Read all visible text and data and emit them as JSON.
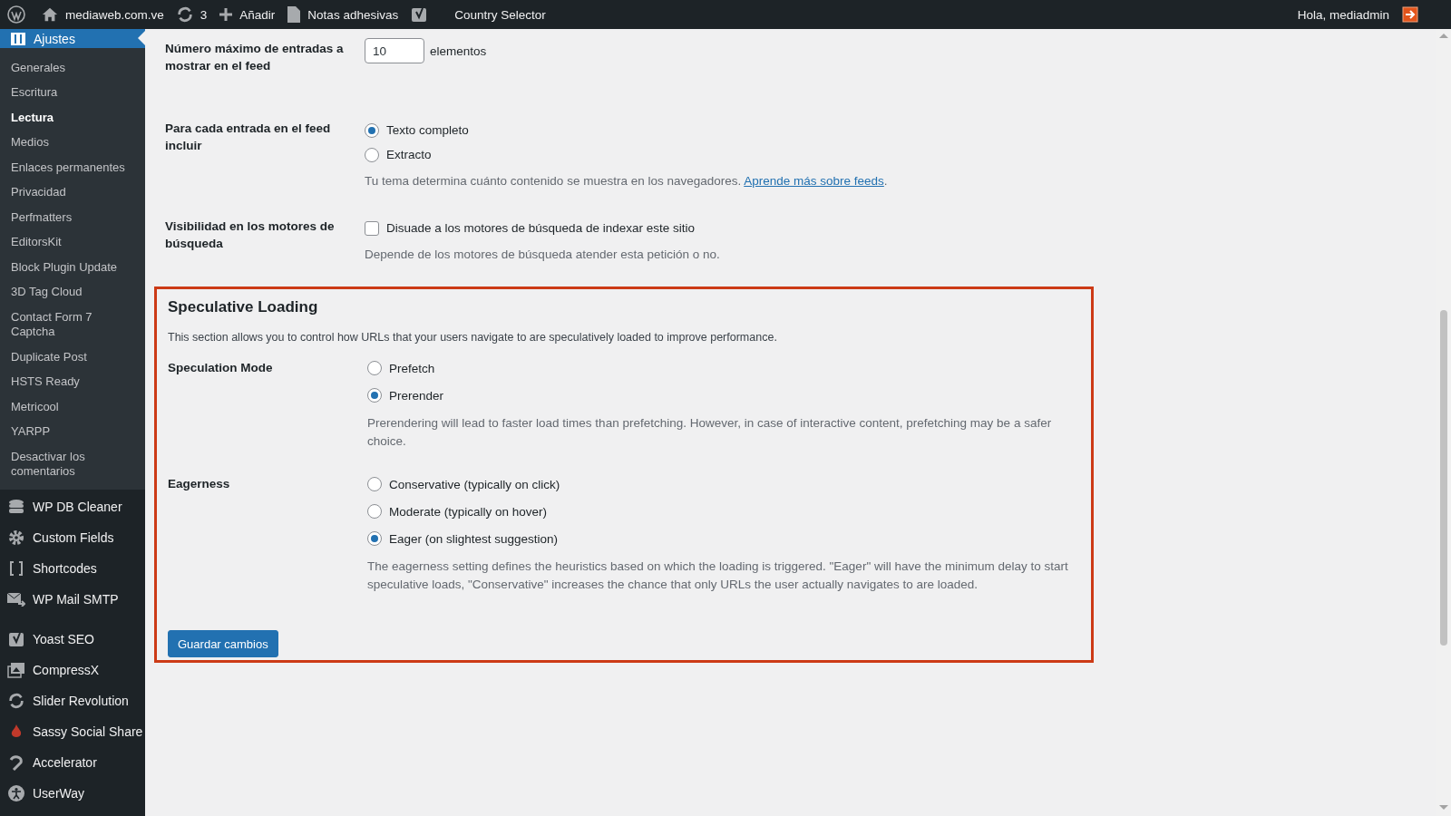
{
  "admin_bar": {
    "site": "mediaweb.com.ve",
    "updates": "3",
    "new": "Añadir",
    "notes": "Notas adhesivas",
    "country": "Country Selector",
    "greeting": "Hola, mediadmin"
  },
  "sidebar": {
    "current": {
      "label": "Ajustes"
    },
    "submenu": [
      {
        "label": "Generales",
        "selected": false
      },
      {
        "label": "Escritura",
        "selected": false
      },
      {
        "label": "Lectura",
        "selected": true
      },
      {
        "label": "Medios",
        "selected": false
      },
      {
        "label": "Enlaces permanentes",
        "selected": false
      },
      {
        "label": "Privacidad",
        "selected": false
      },
      {
        "label": "Perfmatters",
        "selected": false
      },
      {
        "label": "EditorsKit",
        "selected": false
      },
      {
        "label": "Block Plugin Update",
        "selected": false
      },
      {
        "label": "3D Tag Cloud",
        "selected": false
      },
      {
        "label": "Contact Form 7 Captcha",
        "selected": false
      },
      {
        "label": "Duplicate Post",
        "selected": false
      },
      {
        "label": "HSTS Ready",
        "selected": false
      },
      {
        "label": "Metricool",
        "selected": false
      },
      {
        "label": "YARPP",
        "selected": false
      },
      {
        "label": "Desactivar los comentarios",
        "selected": false
      }
    ],
    "menu_groups": [
      [
        {
          "label": "WP DB Cleaner",
          "kind": "database"
        },
        {
          "label": "Custom Fields",
          "kind": "gear"
        },
        {
          "label": "Shortcodes",
          "kind": "brackets"
        },
        {
          "label": "WP Mail SMTP",
          "kind": "mail"
        }
      ],
      [
        {
          "label": "Yoast SEO",
          "kind": "yoast"
        },
        {
          "label": "CompressX",
          "kind": "images"
        },
        {
          "label": "Slider Revolution",
          "kind": "cycle"
        },
        {
          "label": "Sassy Social Share",
          "kind": "flame"
        },
        {
          "label": "Accelerator",
          "kind": "hook"
        },
        {
          "label": "UserWay",
          "kind": "person"
        }
      ]
    ]
  },
  "feed_settings": [
    {
      "label": "Número máximo de entradas a mostrar en el feed",
      "kind": "number",
      "value": "10",
      "suffix": "elementos"
    },
    {
      "label": "Para cada entrada en el feed incluir",
      "kind": "radios",
      "options": [
        {
          "label": "Texto completo",
          "selected": true
        },
        {
          "label": "Extracto",
          "selected": false
        }
      ],
      "help": "Tu tema determina cuánto contenido se muestra en los navegadores.",
      "help_link": "Aprende más sobre feeds",
      "help_end": "."
    },
    {
      "label": "Visibilidad en los motores de búsqueda",
      "kind": "checkbox",
      "checkbox": {
        "label": "Disuade a los motores de búsqueda de indexar este sitio",
        "checked": false
      },
      "help": "Depende de los motores de búsqueda atender esta petición o no."
    }
  ],
  "speculative_loading": {
    "title": "Speculative Loading",
    "description": "This section allows you to control how URLs that your users navigate to are speculatively loaded to improve performance.",
    "fields": [
      {
        "label": "Speculation Mode",
        "options": [
          {
            "label": "Prefetch",
            "selected": false
          },
          {
            "label": "Prerender",
            "selected": true
          }
        ],
        "help": "Prerendering will lead to faster load times than prefetching. However, in case of interactive content, prefetching may be a safer choice."
      },
      {
        "label": "Eagerness",
        "options": [
          {
            "label": "Conservative (typically on click)",
            "selected": false
          },
          {
            "label": "Moderate (typically on hover)",
            "selected": false
          },
          {
            "label": "Eager (on slightest suggestion)",
            "selected": true
          }
        ],
        "help": "The eagerness setting defines the heuristics based on which the loading is triggered. \"Eager\" will have the minimum delay to start speculative loads, \"Conservative\" increases the chance that only URLs the user actually navigates to are loaded."
      }
    ],
    "save_button": "Guardar cambios"
  }
}
